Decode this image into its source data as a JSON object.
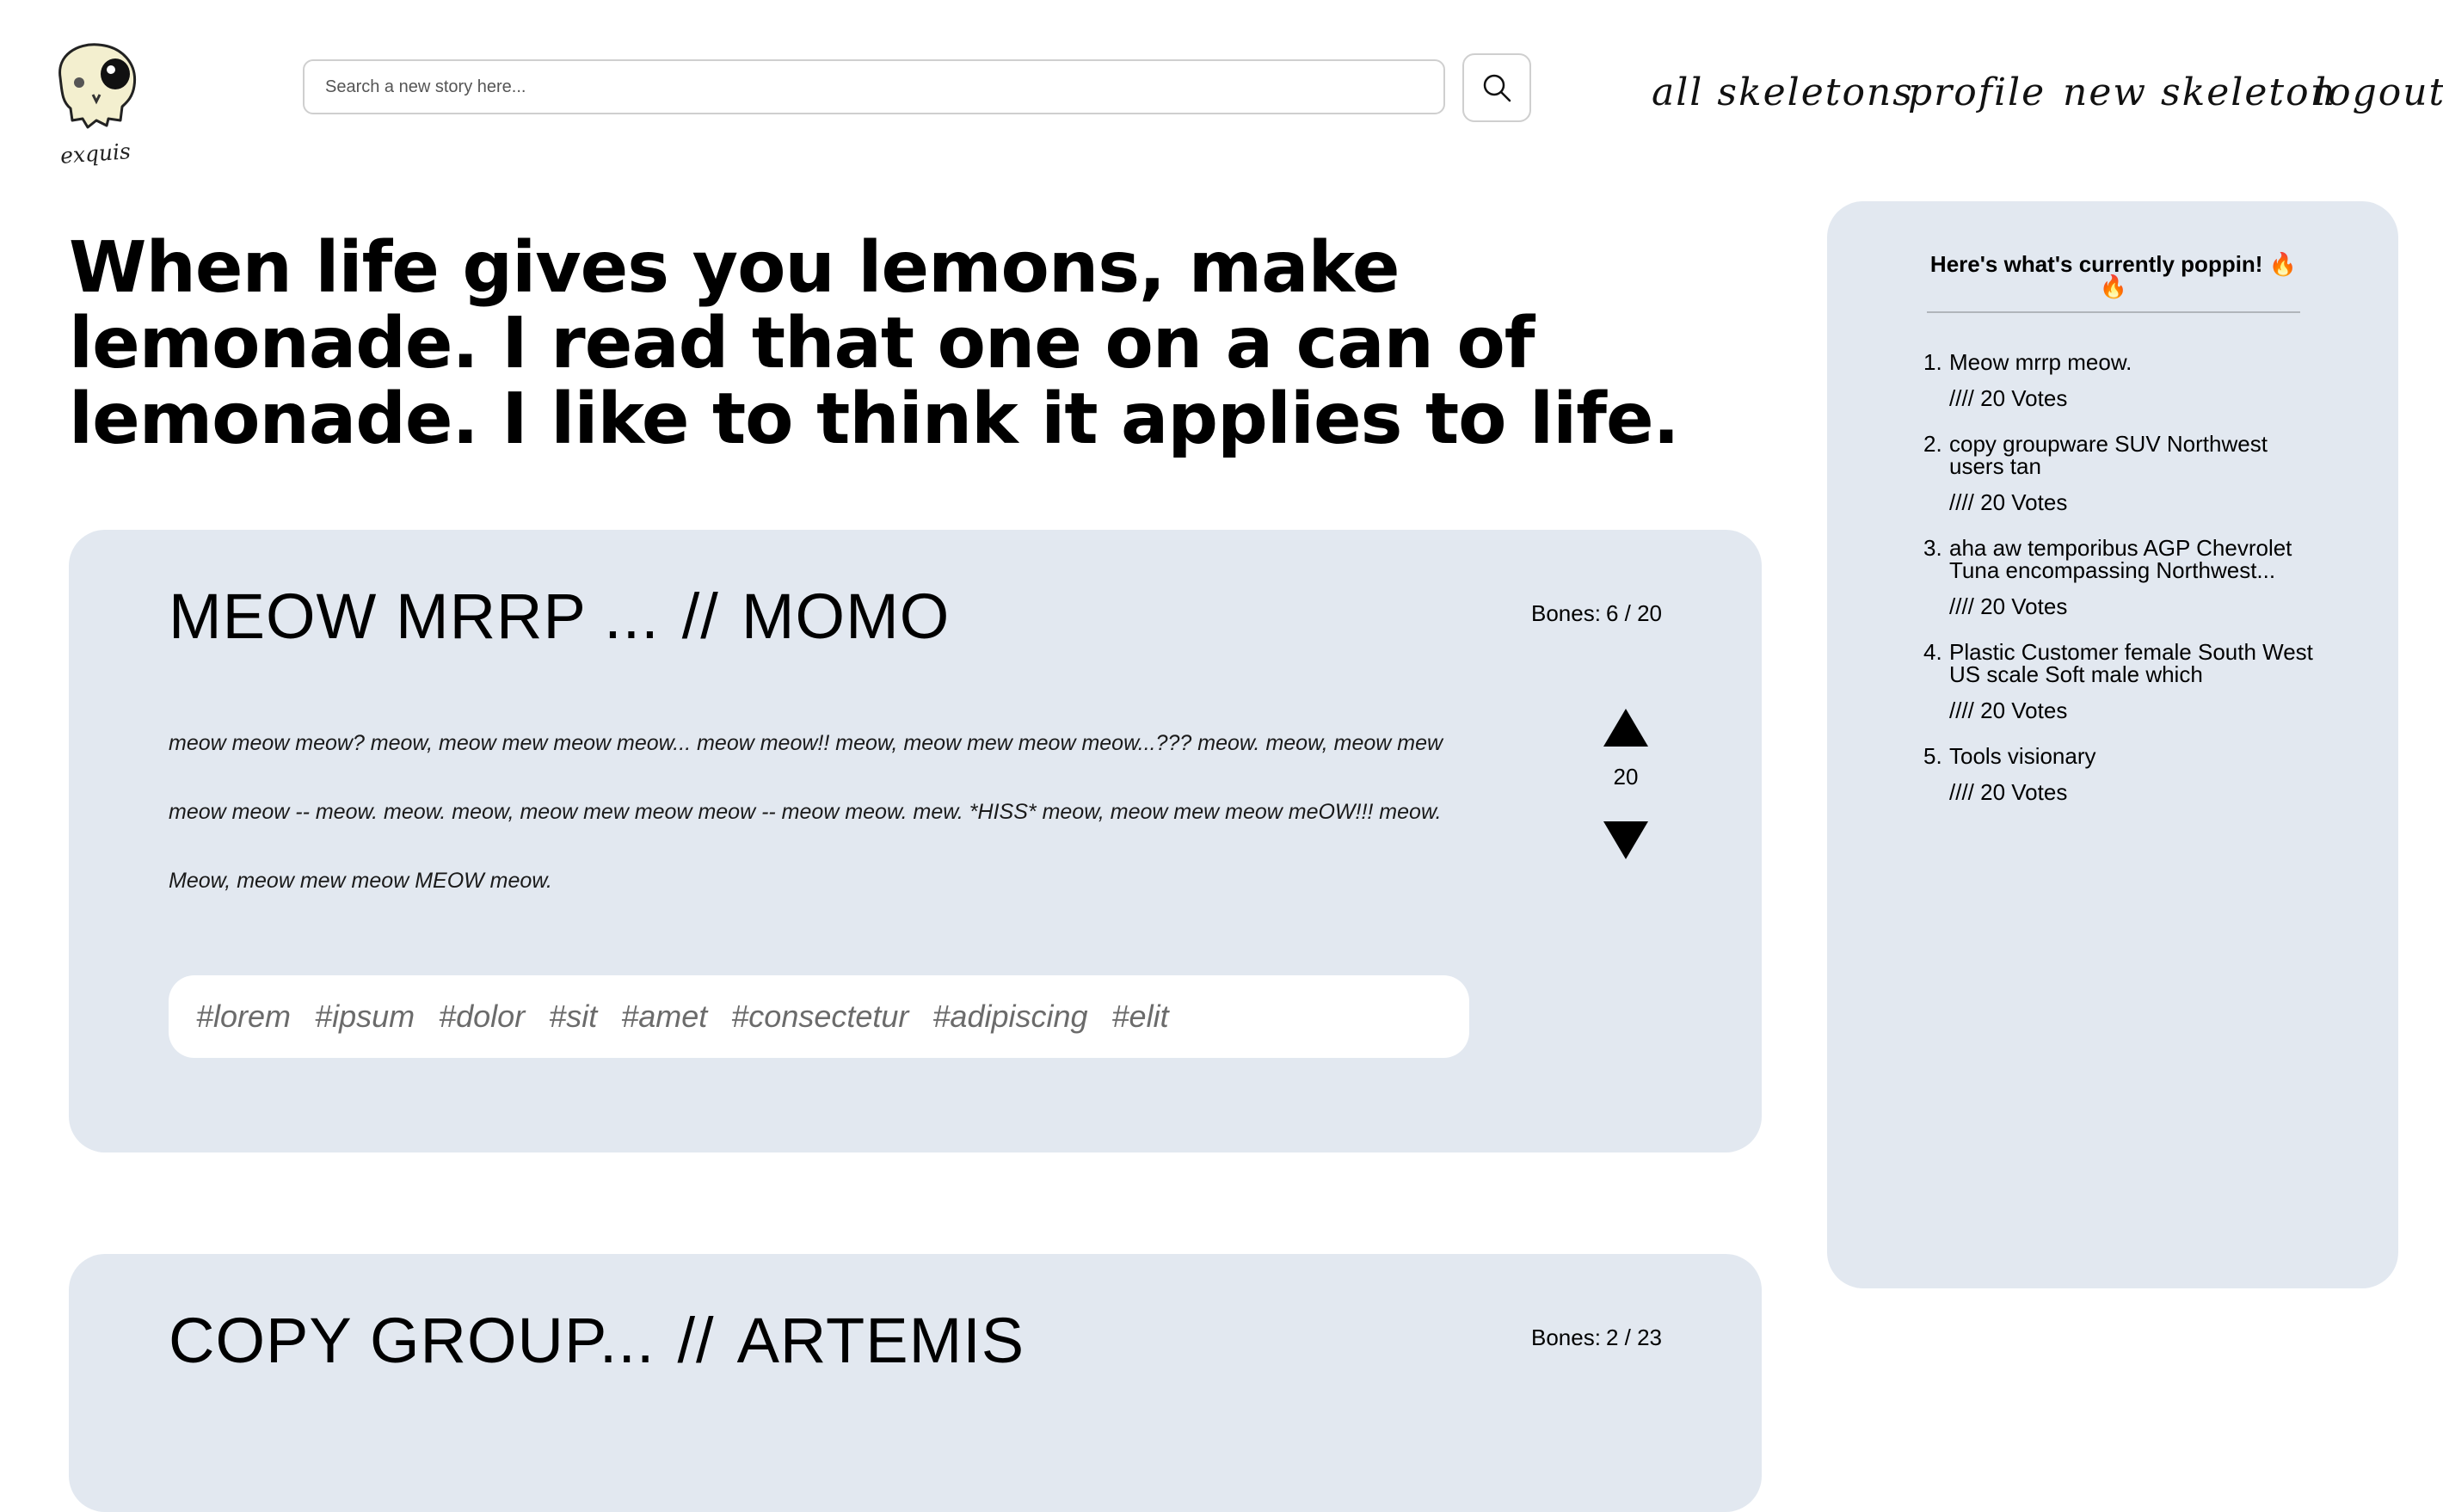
{
  "header": {
    "logo_text": "exquis",
    "search": {
      "placeholder": "Search a new story here..."
    },
    "nav": [
      {
        "label": "all skeletons"
      },
      {
        "label": "profile"
      },
      {
        "label": "new skeleton"
      },
      {
        "label": "logout"
      }
    ]
  },
  "headline": "When life gives you lemons, make lemonade. I read that one on a can of lemonade. I like to think it applies to life.",
  "stories": [
    {
      "title": "MEOW MRRP ...",
      "separator": "//",
      "author": "MOMO",
      "bones_label": "Bones:",
      "bones": "6 / 20",
      "text": "meow meow meow? meow, meow mew meow meow... meow meow!! meow, meow mew meow meow...??? meow. meow, meow mew meow meow -- meow. meow. meow, meow mew meow meow -- meow meow. mew. *HISS* meow, meow mew meow meOW!!! meow. Meow, meow mew meow MEOW meow.",
      "votes": "20",
      "tags": [
        "#lorem",
        "#ipsum",
        "#dolor",
        "#sit",
        "#amet",
        "#consectetur",
        "#adipiscing",
        "#elit"
      ]
    },
    {
      "title": "COPY GROUP...",
      "separator": "//",
      "author": "ARTEMIS",
      "bones_label": "Bones:",
      "bones": "2 / 23"
    }
  ],
  "sidebar": {
    "title": "Here's what's currently poppin! 🔥🔥",
    "items": [
      {
        "num": "1.",
        "title": "Meow mrrp meow.",
        "votes": "//// 20 Votes"
      },
      {
        "num": "2.",
        "title": "copy groupware SUV Northwest users tan",
        "votes": "//// 20 Votes"
      },
      {
        "num": "3.",
        "title": "aha aw temporibus AGP Chevrolet Tuna encompassing Northwest...",
        "votes": "//// 20 Votes"
      },
      {
        "num": "4.",
        "title": "Plastic Customer female South West US scale Soft male which",
        "votes": "//// 20 Votes"
      },
      {
        "num": "5.",
        "title": "Tools visionary",
        "votes": "//// 20 Votes"
      }
    ]
  }
}
